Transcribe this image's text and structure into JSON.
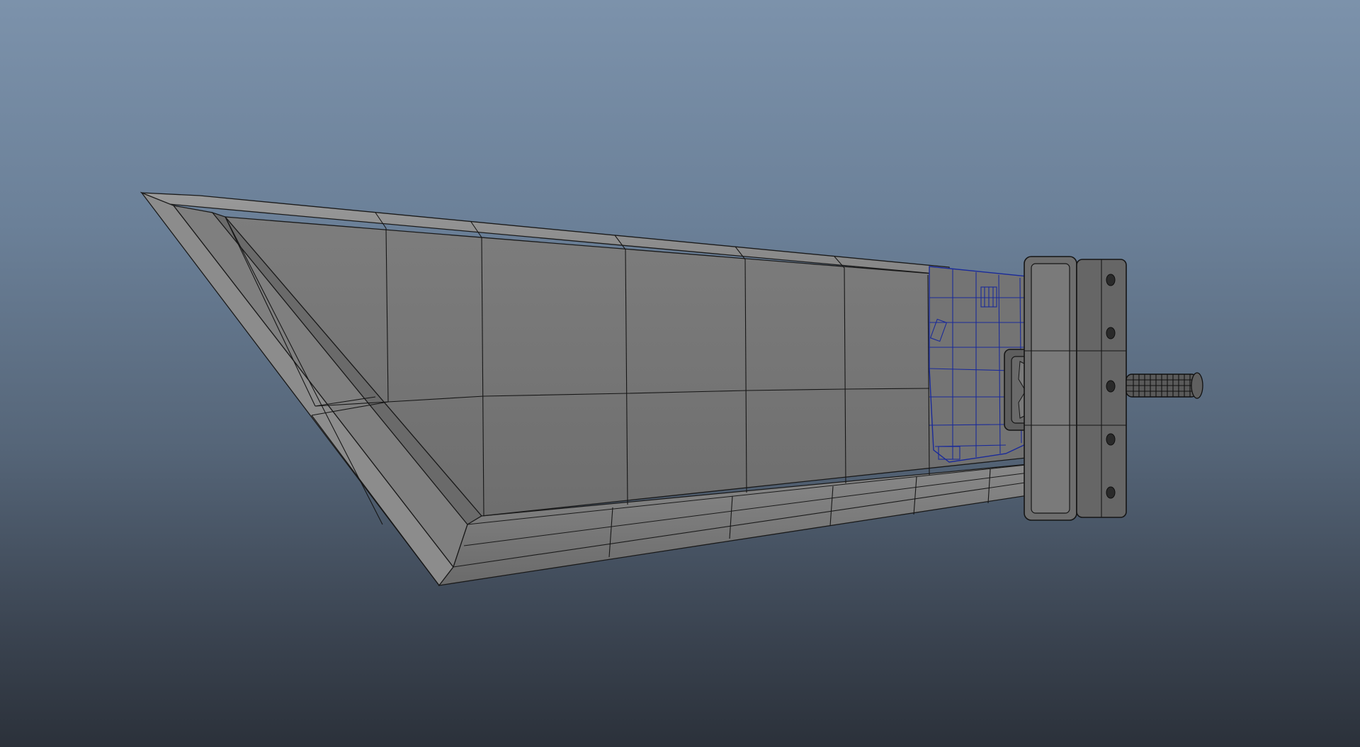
{
  "viewport": {
    "background_top": "#7c92ab",
    "background_bottom": "#2b313a"
  },
  "model": {
    "shaded_color": "#787878",
    "wire_color": "#161616",
    "selected_wire_color": "#1a2a9a",
    "handle_color": "#5a5a5a",
    "selected_object": "sword-guard"
  }
}
